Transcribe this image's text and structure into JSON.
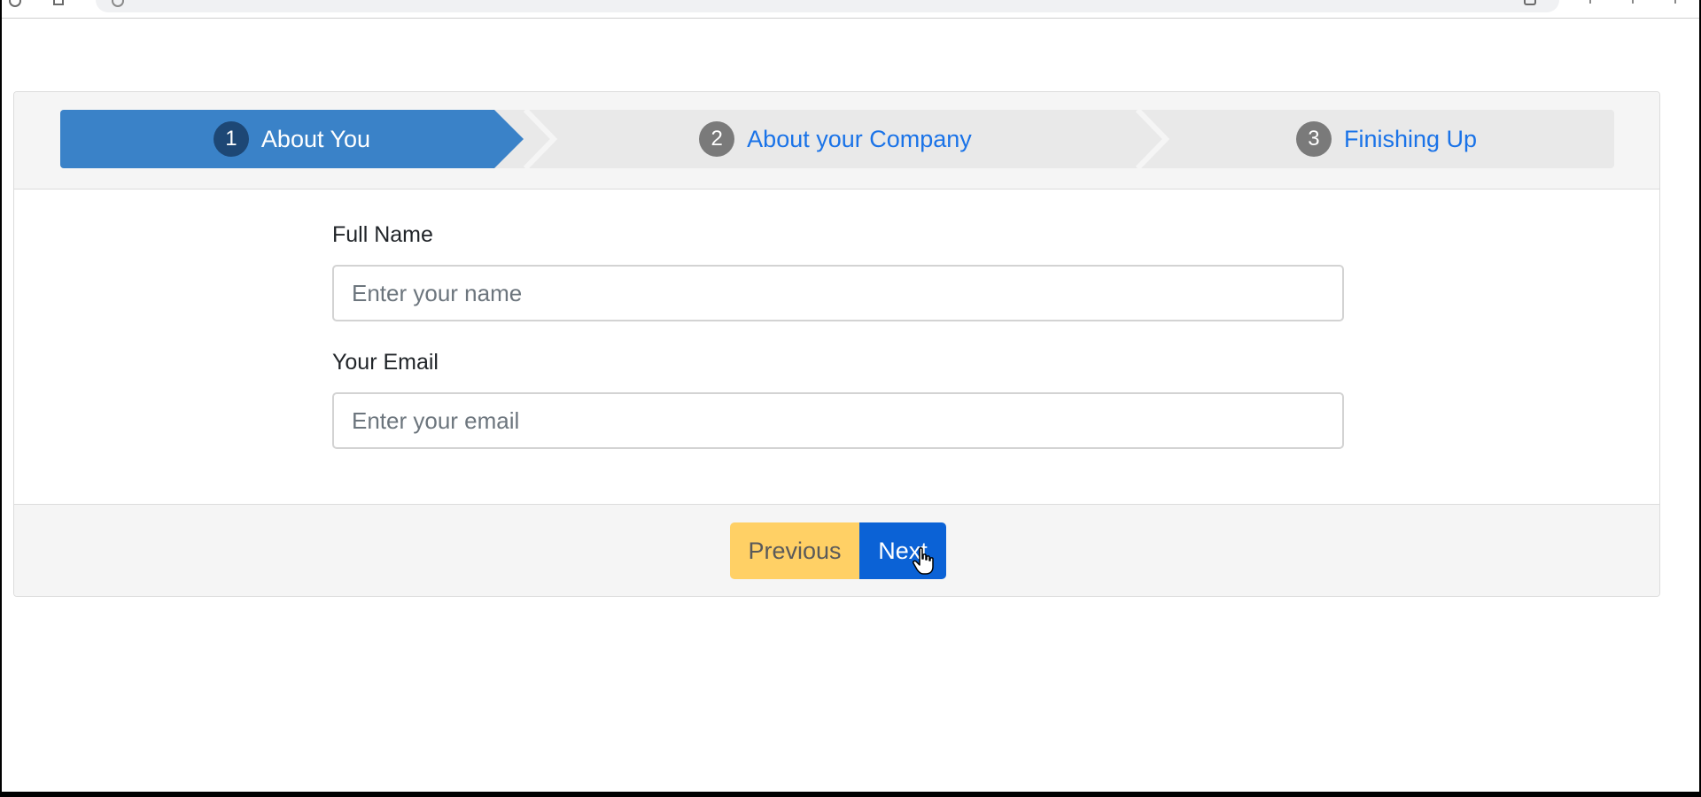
{
  "wizard": {
    "steps": [
      {
        "number": "1",
        "label": "About You",
        "active": true
      },
      {
        "number": "2",
        "label": "About your Company",
        "active": false
      },
      {
        "number": "3",
        "label": "Finishing Up",
        "active": false
      }
    ],
    "fields": {
      "name": {
        "label": "Full Name",
        "placeholder": "Enter your name",
        "value": ""
      },
      "email": {
        "label": "Your Email",
        "placeholder": "Enter your email",
        "value": ""
      }
    },
    "buttons": {
      "previous": "Previous",
      "next": "Next"
    }
  },
  "colors": {
    "active_step": "#3a82c8",
    "inactive_step": "#e9e9e9",
    "link_text": "#1a73e8",
    "previous_button": "#ffd065",
    "next_button": "#0b62d6"
  },
  "icons": [
    "back-icon",
    "home-icon",
    "site-info-icon",
    "bookmark-icon",
    "hand-cursor-icon"
  ]
}
